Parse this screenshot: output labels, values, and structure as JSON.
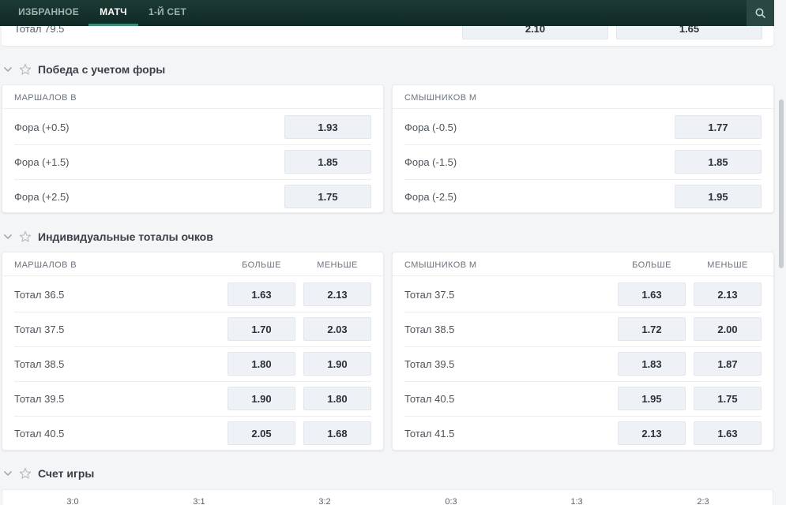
{
  "nav": {
    "tabs": [
      {
        "label": "ИЗБРАННОЕ",
        "active": false
      },
      {
        "label": "МАТЧ",
        "active": true
      },
      {
        "label": "1-Й СЕТ",
        "active": false
      }
    ],
    "search_icon": "search-icon"
  },
  "prev_row": {
    "label": "Тотал 79.5",
    "over": "2.10",
    "under": "1.65"
  },
  "handicap": {
    "title": "Победа с учетом форы",
    "left": {
      "player": "МАРШАЛОВ В",
      "rows": [
        {
          "label": "Фора (+0.5)",
          "odd": "1.93"
        },
        {
          "label": "Фора (+1.5)",
          "odd": "1.85"
        },
        {
          "label": "Фора (+2.5)",
          "odd": "1.75"
        }
      ]
    },
    "right": {
      "player": "СМЫШНИКОВ М",
      "rows": [
        {
          "label": "Фора (-0.5)",
          "odd": "1.77"
        },
        {
          "label": "Фора (-1.5)",
          "odd": "1.85"
        },
        {
          "label": "Фора (-2.5)",
          "odd": "1.95"
        }
      ]
    }
  },
  "individual_totals": {
    "title": "Индивидуальные тоталы очков",
    "over_label": "БОЛЬШЕ",
    "under_label": "МЕНЬШЕ",
    "left": {
      "player": "МАРШАЛОВ В",
      "rows": [
        {
          "label": "Тотал 36.5",
          "over": "1.63",
          "under": "2.13"
        },
        {
          "label": "Тотал 37.5",
          "over": "1.70",
          "under": "2.03"
        },
        {
          "label": "Тотал 38.5",
          "over": "1.80",
          "under": "1.90"
        },
        {
          "label": "Тотал 39.5",
          "over": "1.90",
          "under": "1.80"
        },
        {
          "label": "Тотал 40.5",
          "over": "2.05",
          "under": "1.68"
        }
      ]
    },
    "right": {
      "player": "СМЫШНИКОВ М",
      "rows": [
        {
          "label": "Тотал 37.5",
          "over": "1.63",
          "under": "2.13"
        },
        {
          "label": "Тотал 38.5",
          "over": "1.72",
          "under": "2.00"
        },
        {
          "label": "Тотал 39.5",
          "over": "1.83",
          "under": "1.87"
        },
        {
          "label": "Тотал 40.5",
          "over": "1.95",
          "under": "1.75"
        },
        {
          "label": "Тотал 41.5",
          "over": "2.13",
          "under": "1.63"
        }
      ]
    }
  },
  "game_score": {
    "title": "Счет игры",
    "scores": [
      "3:0",
      "3:1",
      "3:2",
      "0:3",
      "1:3",
      "2:3"
    ]
  },
  "colors": {
    "nav_bg": "#0f2924",
    "active_tab_underline": "#3e8a7a",
    "odd_bg": "#eef1f5",
    "page_bg": "#f4f5f7"
  }
}
